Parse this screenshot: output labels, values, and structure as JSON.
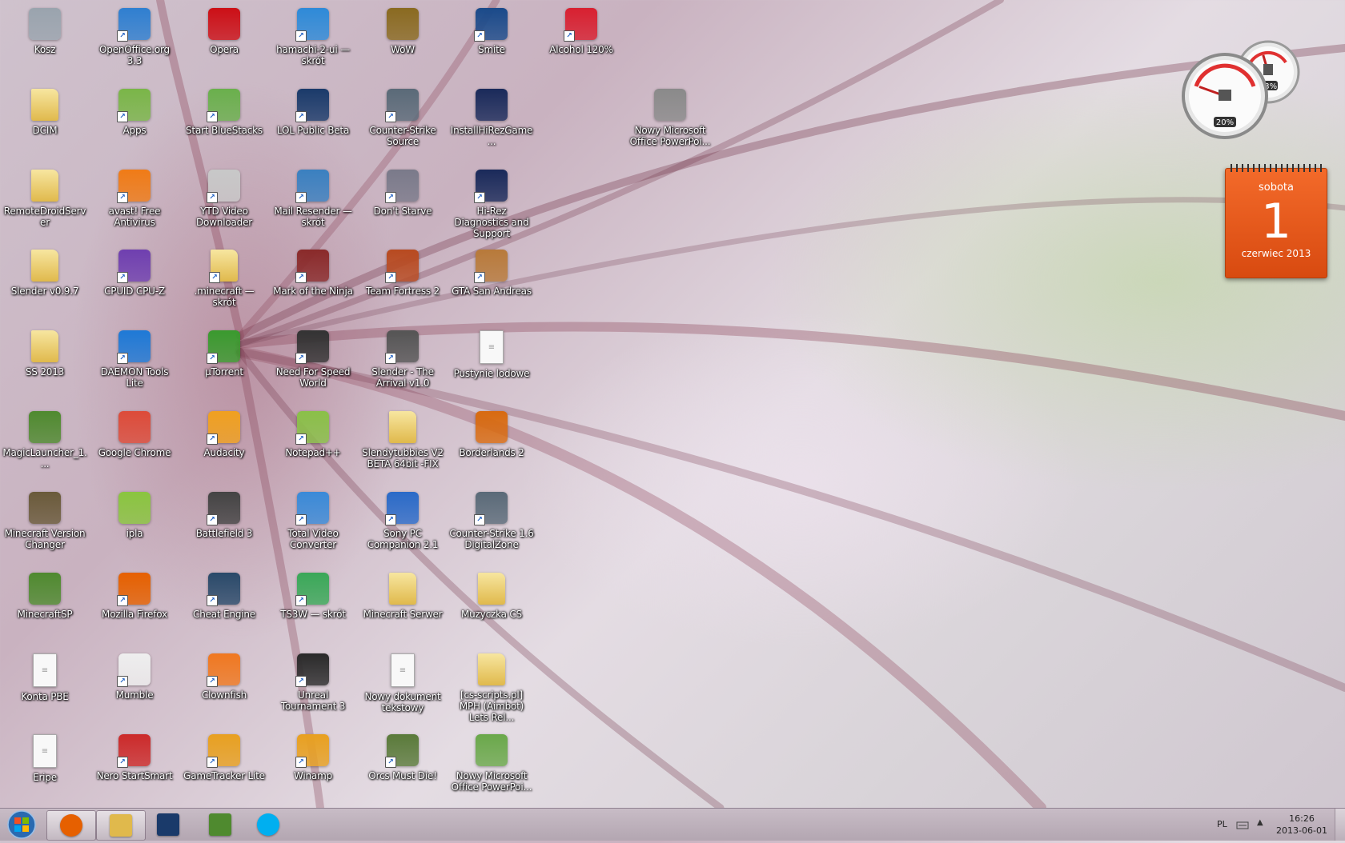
{
  "desktop": {
    "icons": [
      {
        "label": "Kosz",
        "kind": "bin",
        "color": "#9aa4ae",
        "glyph": "",
        "shortcut": false
      },
      {
        "label": "DCIM",
        "kind": "folder",
        "color": "",
        "glyph": "",
        "shortcut": false
      },
      {
        "label": "RemoteDroidServer",
        "kind": "folder",
        "color": "",
        "glyph": "",
        "shortcut": false
      },
      {
        "label": "Slender v0.9.7",
        "kind": "folder",
        "color": "",
        "glyph": "",
        "shortcut": false
      },
      {
        "label": "SS 2013",
        "kind": "folder",
        "color": "",
        "glyph": "",
        "shortcut": false
      },
      {
        "label": "MagicLauncher_1....",
        "kind": "app",
        "color": "#4f8a2f",
        "glyph": "",
        "shortcut": false
      },
      {
        "label": "Minecraft Version Changer",
        "kind": "app",
        "color": "#6a5a3a",
        "glyph": "",
        "shortcut": false
      },
      {
        "label": "MinecraftSP",
        "kind": "app",
        "color": "#4f8a2f",
        "glyph": "",
        "shortcut": false
      },
      {
        "label": "Konta PBE",
        "kind": "doc",
        "color": "",
        "glyph": "",
        "shortcut": false
      },
      {
        "label": "Eripe",
        "kind": "doc",
        "color": "",
        "glyph": "",
        "shortcut": false
      },
      {
        "label": "OpenOffice.org 3.3",
        "kind": "app",
        "color": "#2f7fd0",
        "glyph": "",
        "shortcut": true
      },
      {
        "label": "Apps",
        "kind": "app",
        "color": "#7ab648",
        "glyph": "",
        "shortcut": true
      },
      {
        "label": "avast! Free Antivirus",
        "kind": "app",
        "color": "#f07b16",
        "glyph": "",
        "shortcut": true
      },
      {
        "label": "CPUID CPU-Z",
        "kind": "app",
        "color": "#6f3fb0",
        "glyph": "",
        "shortcut": true
      },
      {
        "label": "DAEMON Tools Lite",
        "kind": "app",
        "color": "#1e79d6",
        "glyph": "",
        "shortcut": true
      },
      {
        "label": "Google Chrome",
        "kind": "app",
        "color": "#dd4b39",
        "glyph": "",
        "shortcut": false
      },
      {
        "label": "ipla",
        "kind": "app",
        "color": "#8ac53f",
        "glyph": "",
        "shortcut": false
      },
      {
        "label": "Mozilla Firefox",
        "kind": "app",
        "color": "#e66000",
        "glyph": "",
        "shortcut": true
      },
      {
        "label": "Mumble",
        "kind": "app",
        "color": "#eeeeee",
        "glyph": "",
        "shortcut": true
      },
      {
        "label": "Nero StartSmart",
        "kind": "app",
        "color": "#cc2a2a",
        "glyph": "",
        "shortcut": true
      },
      {
        "label": "Opera",
        "kind": "app",
        "color": "#cc0f16",
        "glyph": "",
        "shortcut": false
      },
      {
        "label": "Start BlueStacks",
        "kind": "app",
        "color": "#6ab04c",
        "glyph": "",
        "shortcut": true
      },
      {
        "label": "YTD Video Downloader",
        "kind": "app",
        "color": "#c8c8c8",
        "glyph": "",
        "shortcut": true
      },
      {
        "label": ".minecraft — skrót",
        "kind": "folder",
        "color": "",
        "glyph": "",
        "shortcut": true
      },
      {
        "label": "µTorrent",
        "kind": "app",
        "color": "#3a9a2e",
        "glyph": "",
        "shortcut": true
      },
      {
        "label": "Audacity",
        "kind": "app",
        "color": "#f0a020",
        "glyph": "",
        "shortcut": true
      },
      {
        "label": "Battlefield 3",
        "kind": "app",
        "color": "#444444",
        "glyph": "",
        "shortcut": true
      },
      {
        "label": "Cheat Engine",
        "kind": "app",
        "color": "#2a4a6a",
        "glyph": "",
        "shortcut": true
      },
      {
        "label": "Clownfish",
        "kind": "app",
        "color": "#f07820",
        "glyph": "",
        "shortcut": true
      },
      {
        "label": "GameTracker Lite",
        "kind": "app",
        "color": "#e8a020",
        "glyph": "",
        "shortcut": true
      },
      {
        "label": "hamachi-2-ui — skrót",
        "kind": "app",
        "color": "#2e8ad8",
        "glyph": "",
        "shortcut": true
      },
      {
        "label": "LOL Public Beta",
        "kind": "app",
        "color": "#1a3a6a",
        "glyph": "",
        "shortcut": true
      },
      {
        "label": "Mail Resender — skrót",
        "kind": "app",
        "color": "#3a80c0",
        "glyph": "",
        "shortcut": true
      },
      {
        "label": "Mark of the Ninja",
        "kind": "app",
        "color": "#8a2a2a",
        "glyph": "",
        "shortcut": true
      },
      {
        "label": "Need For Speed World",
        "kind": "app",
        "color": "#333333",
        "glyph": "",
        "shortcut": true
      },
      {
        "label": "Notepad++",
        "kind": "app",
        "color": "#8ac048",
        "glyph": "",
        "shortcut": true
      },
      {
        "label": "Total Video Converter",
        "kind": "app",
        "color": "#3a8ad8",
        "glyph": "",
        "shortcut": true
      },
      {
        "label": "TS3W — skrót",
        "kind": "app",
        "color": "#3aa858",
        "glyph": "",
        "shortcut": true
      },
      {
        "label": "Unreal Tournament 3",
        "kind": "app",
        "color": "#2a2a2a",
        "glyph": "",
        "shortcut": true
      },
      {
        "label": "Winamp",
        "kind": "app",
        "color": "#e8a020",
        "glyph": "",
        "shortcut": true
      },
      {
        "label": "WoW",
        "kind": "app",
        "color": "#8a6a20",
        "glyph": "",
        "shortcut": false
      },
      {
        "label": "Counter-Strike Source",
        "kind": "app",
        "color": "#5a6a78",
        "glyph": "",
        "shortcut": true
      },
      {
        "label": "Don't Starve",
        "kind": "app",
        "color": "#7a7a8a",
        "glyph": "",
        "shortcut": true
      },
      {
        "label": "Team Fortress 2",
        "kind": "app",
        "color": "#b84a20",
        "glyph": "",
        "shortcut": true
      },
      {
        "label": "Slender - The Arrival v1.0",
        "kind": "app",
        "color": "#555555",
        "glyph": "",
        "shortcut": true
      },
      {
        "label": "Slendytubbies V2 BETA 64bit -FIX",
        "kind": "folder",
        "color": "",
        "glyph": "",
        "shortcut": false
      },
      {
        "label": "Sony PC Companion 2.1",
        "kind": "app",
        "color": "#2a6ac8",
        "glyph": "",
        "shortcut": true
      },
      {
        "label": "Minecraft Serwer",
        "kind": "folder",
        "color": "",
        "glyph": "",
        "shortcut": false
      },
      {
        "label": "Nowy dokument tekstowy",
        "kind": "doc",
        "color": "",
        "glyph": "",
        "shortcut": false
      },
      {
        "label": "Orcs Must Die!",
        "kind": "app",
        "color": "#5a7a3a",
        "glyph": "",
        "shortcut": true
      },
      {
        "label": "Smite",
        "kind": "app",
        "color": "#1a4a8a",
        "glyph": "",
        "shortcut": true
      },
      {
        "label": "InstallHiRezGame...",
        "kind": "app",
        "color": "#1a2a5a",
        "glyph": "",
        "shortcut": false
      },
      {
        "label": "Hi-Rez Diagnostics and Support",
        "kind": "app",
        "color": "#1a2a5a",
        "glyph": "",
        "shortcut": true
      },
      {
        "label": "GTA San Andreas",
        "kind": "app",
        "color": "#b87a3a",
        "glyph": "",
        "shortcut": true
      },
      {
        "label": "Pustynie lodowe",
        "kind": "doc",
        "color": "",
        "glyph": "",
        "shortcut": false
      },
      {
        "label": "Borderlands 2",
        "kind": "app",
        "color": "#d86a10",
        "glyph": "",
        "shortcut": false
      },
      {
        "label": "Counter-Strike 1.6 DigitalZone",
        "kind": "app",
        "color": "#5a6a78",
        "glyph": "",
        "shortcut": true
      },
      {
        "label": "Muzyczka CS",
        "kind": "folder",
        "color": "",
        "glyph": "",
        "shortcut": false
      },
      {
        "label": "[cs-scripts.pl] MPH (Aimbot) Lets Rel...",
        "kind": "folder",
        "color": "",
        "glyph": "",
        "shortcut": false
      },
      {
        "label": "Nowy Microsoft Office PowerPoi...",
        "kind": "app",
        "color": "#6aa84a",
        "glyph": "",
        "shortcut": false
      },
      {
        "label": "Alcohol 120%",
        "kind": "app",
        "color": "#d82030",
        "glyph": "",
        "shortcut": true
      },
      {
        "label": "Nowy Microsoft Office PowerPoi...",
        "kind": "app",
        "color": "#8a8a8a",
        "glyph": "",
        "shortcut": false
      }
    ]
  },
  "gadgets": {
    "meter": {
      "cpu_label": "20%",
      "memory_label": "43%",
      "cpu": 0.2,
      "memory": 0.43
    },
    "calendar": {
      "day_name": "sobota",
      "day_number": "1",
      "month_year": "czerwiec 2013"
    }
  },
  "taskbar": {
    "apps": [
      {
        "name": "taskbar-firefox",
        "icon": "firefox-icon",
        "color": "#e66000",
        "active": true
      },
      {
        "name": "taskbar-explorer",
        "icon": "folder-icon",
        "color": "#e0b94c",
        "active": true
      },
      {
        "name": "taskbar-lol",
        "icon": "lol-icon",
        "color": "#1a3a6a",
        "active": false
      },
      {
        "name": "taskbar-minecraft",
        "icon": "minecraft-icon",
        "color": "#4f8a2f",
        "active": false
      },
      {
        "name": "taskbar-skype",
        "icon": "skype-icon",
        "color": "#00aff0",
        "active": false
      }
    ],
    "language": "PL",
    "time": "16:26",
    "date": "2013-06-01"
  }
}
